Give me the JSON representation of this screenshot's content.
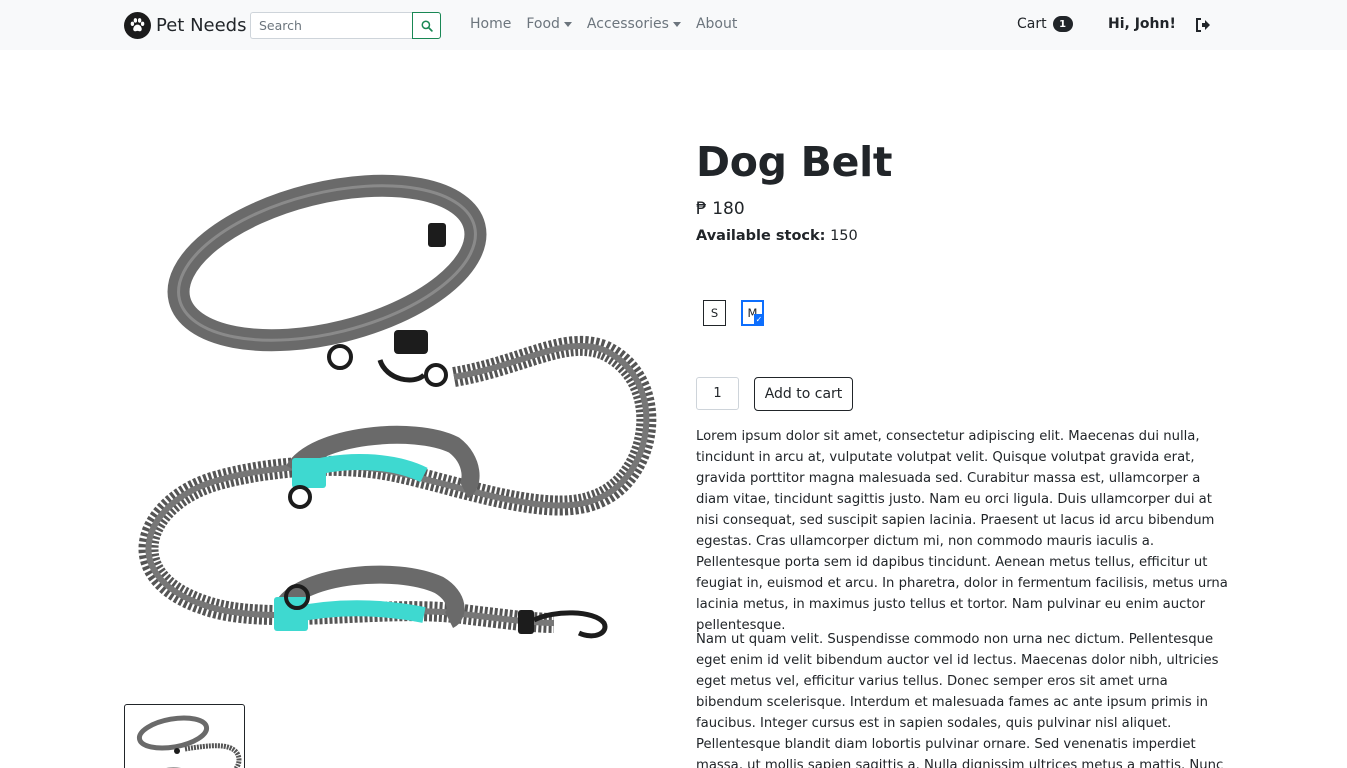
{
  "navbar": {
    "brand": "Pet Needs",
    "search_placeholder": "Search",
    "links": [
      {
        "label": "Home",
        "dropdown": false
      },
      {
        "label": "Food",
        "dropdown": true
      },
      {
        "label": "Accessories",
        "dropdown": true
      },
      {
        "label": "About",
        "dropdown": false
      }
    ],
    "cart_label": "Cart",
    "cart_count": "1",
    "greeting": "Hi, John!"
  },
  "product": {
    "title": "Dog Belt",
    "price": "₱ 180",
    "stock_label": "Available stock:",
    "stock_value": "150",
    "sizes": [
      {
        "label": "S",
        "selected": false
      },
      {
        "label": "M",
        "selected": true
      }
    ],
    "quantity": "1",
    "add_to_cart_label": "Add to cart",
    "description": [
      "Lorem ipsum dolor sit amet, consectetur adipiscing elit. Maecenas dui nulla, tincidunt in arcu at, vulputate volutpat velit. Quisque volutpat gravida erat, gravida porttitor magna malesuada sed. Curabitur massa est, ullamcorper a diam vitae, tincidunt sagittis justo. Nam eu orci ligula. Duis ullamcorper dui at nisi consequat, sed suscipit sapien lacinia. Praesent ut lacus id arcu bibendum egestas. Cras ullamcorper dictum mi, non commodo mauris iaculis a. Pellentesque porta sem id dapibus tincidunt. Aenean metus tellus, efficitur ut feugiat in, euismod et arcu. In pharetra, dolor in fermentum facilisis, metus urna lacinia metus, in maximus justo tellus et tortor. Nam pulvinar eu enim auctor pellentesque.",
      "Nam ut quam velit. Suspendisse commodo non urna nec dictum. Pellentesque eget enim id velit bibendum auctor vel id lectus. Maecenas dolor nibh, ultricies eget metus vel, efficitur varius tellus. Donec semper eros sit amet urna bibendum scelerisque. Interdum et malesuada fames ac ante ipsum primis in faucibus. Integer cursus est in sapien sodales, quis pulvinar nisl aliquet. Pellentesque blandit diam lobortis pulvinar ornare. Sed venenatis imperdiet massa, ut mollis sapien sagittis a. Nulla dignissim ultrices metus a mattis. Nunc egestas mattis nisl at posuere. Donec"
    ]
  },
  "colors": {
    "navbar_bg": "#f8f9fa",
    "search_button_border": "#198754",
    "selected_size": "#0d6efd",
    "leash_gray": "#6e6e6e",
    "handle_teal": "#3ed9d0"
  },
  "icons": [
    "paw-icon",
    "search-icon",
    "logout-icon",
    "check-icon"
  ]
}
